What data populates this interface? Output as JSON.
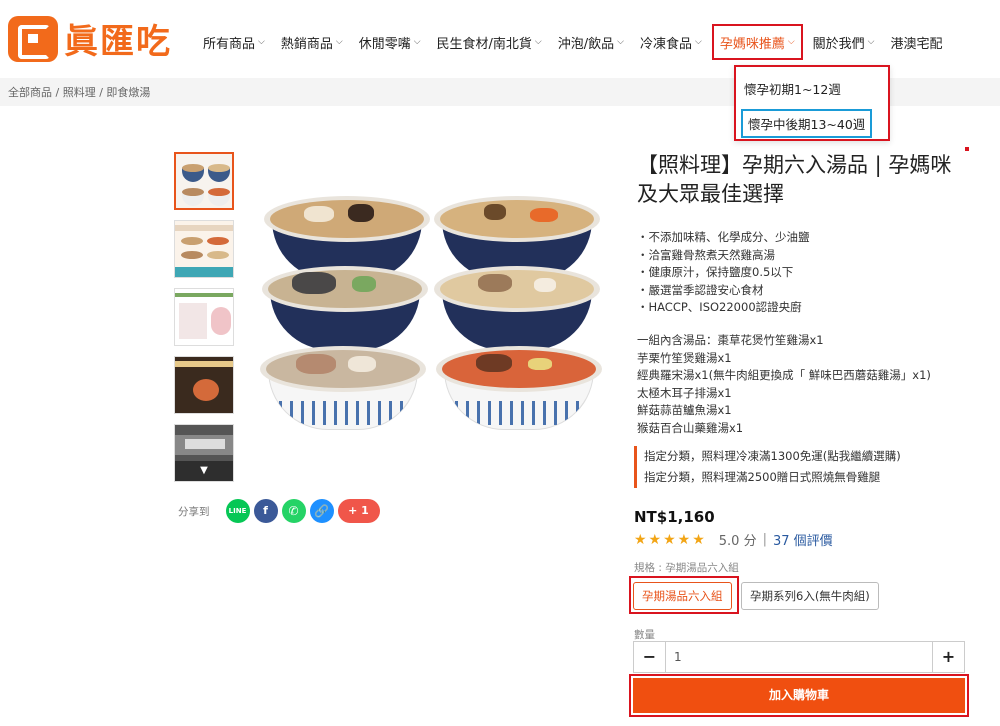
{
  "brand": {
    "name": "眞匯吃"
  },
  "nav": {
    "items": [
      {
        "label": "所有商品",
        "has_dropdown": true
      },
      {
        "label": "熱銷商品",
        "has_dropdown": true
      },
      {
        "label": "休閒零嘴",
        "has_dropdown": true
      },
      {
        "label": "民生食材/南北貨",
        "has_dropdown": true
      },
      {
        "label": "沖泡/飲品",
        "has_dropdown": true
      },
      {
        "label": "冷凍食品",
        "has_dropdown": true
      },
      {
        "label": "孕媽咪推薦",
        "has_dropdown": true,
        "active": true
      },
      {
        "label": "關於我們",
        "has_dropdown": true
      },
      {
        "label": "港澳宅配",
        "has_dropdown": false
      }
    ],
    "dropdown": [
      {
        "label": "懷孕初期1~12週"
      },
      {
        "label": "懷孕中後期13~40週"
      }
    ]
  },
  "breadcrumb": "全部商品 / 照料理 / 即食燉湯",
  "product": {
    "title": "【照料理】孕期六入湯品 | 孕媽咪及大眾最佳選擇",
    "features": [
      "・不添加味精、化學成分、少油鹽",
      "・洽富雞骨熬煮天然雞高湯",
      "・健康原汁，保持鹽度0.5以下",
      "・嚴選當季認證安心食材",
      "・HACCP、ISO22000認證央廚"
    ],
    "contents": [
      "一組內含湯品：棗草花煲竹笙雞湯x1",
      "芋栗竹笙煲雞湯x1",
      "經典羅宋湯x1(無牛肉組更換成「 鮮味巴西蘑菇雞湯」x1)",
      "太極木耳子排湯x1",
      "鮮菇蒜苗鱸魚湯x1",
      "猴菇百合山藥雞湯x1"
    ],
    "promos": [
      "指定分類，照料理冷凍滿1300免運(點我繼續選購)",
      "指定分類，照料理滿2500贈日式照燒無骨雞腿"
    ],
    "price": "NT$1,160",
    "rating": {
      "stars": "★★★★★",
      "score": "5.0 分",
      "reviews": "37 個評價"
    },
    "spec_label": "規格 : 孕期湯品六入組",
    "options": [
      {
        "label": "孕期湯品六入組",
        "selected": true
      },
      {
        "label": "孕期系列6入(無牛肉組)",
        "selected": false
      }
    ],
    "quantity_label": "數量",
    "quantity": "1",
    "add_to_cart": "加入購物車"
  },
  "share": {
    "label": "分享到",
    "buttons": [
      {
        "name": "line",
        "text": "LINE"
      },
      {
        "name": "facebook",
        "text": "f"
      },
      {
        "name": "whatsapp",
        "text": "✆"
      },
      {
        "name": "copy-link",
        "text": "🔗"
      },
      {
        "name": "plus-one",
        "text": "+ 1"
      }
    ]
  },
  "colors": {
    "accent": "#f04f10",
    "highlight_frame": "#d9141f",
    "selected_frame": "#1a9bd7",
    "star": "#f2a516",
    "link": "#2a5aa0"
  }
}
